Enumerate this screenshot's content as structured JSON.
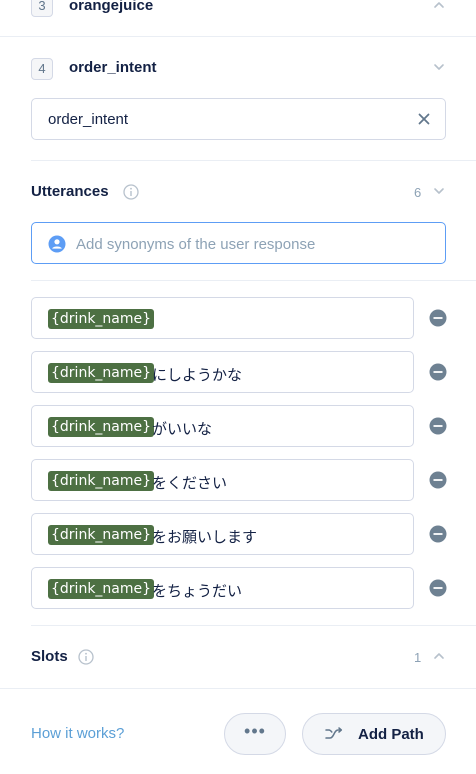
{
  "intents_list": [
    {
      "number": "3",
      "name": "orangejuice"
    },
    {
      "number": "4",
      "name": "order_intent"
    }
  ],
  "intent_name_field": {
    "value": "order_intent"
  },
  "utterances": {
    "title": "Utterances",
    "count": "6",
    "input_placeholder": "Add synonyms of the user response",
    "items": [
      {
        "slot": "{drink_name}",
        "text": ""
      },
      {
        "slot": "{drink_name}",
        "text": "にしようかな"
      },
      {
        "slot": "{drink_name}",
        "text": "がいいな"
      },
      {
        "slot": "{drink_name}",
        "text": "をください"
      },
      {
        "slot": "{drink_name}",
        "text": "をお願いします"
      },
      {
        "slot": "{drink_name}",
        "text": "をちょうだい"
      }
    ]
  },
  "slots": {
    "title": "Slots",
    "count": "1"
  },
  "footer": {
    "how_link": "How it works?",
    "more_label": "•••",
    "add_path_label": "Add Path"
  },
  "colors": {
    "slot_tag_bg": "#4d7043",
    "focus_border": "#5d9df5",
    "link": "#5b9fd6",
    "remove_icon": "#6e8192"
  }
}
